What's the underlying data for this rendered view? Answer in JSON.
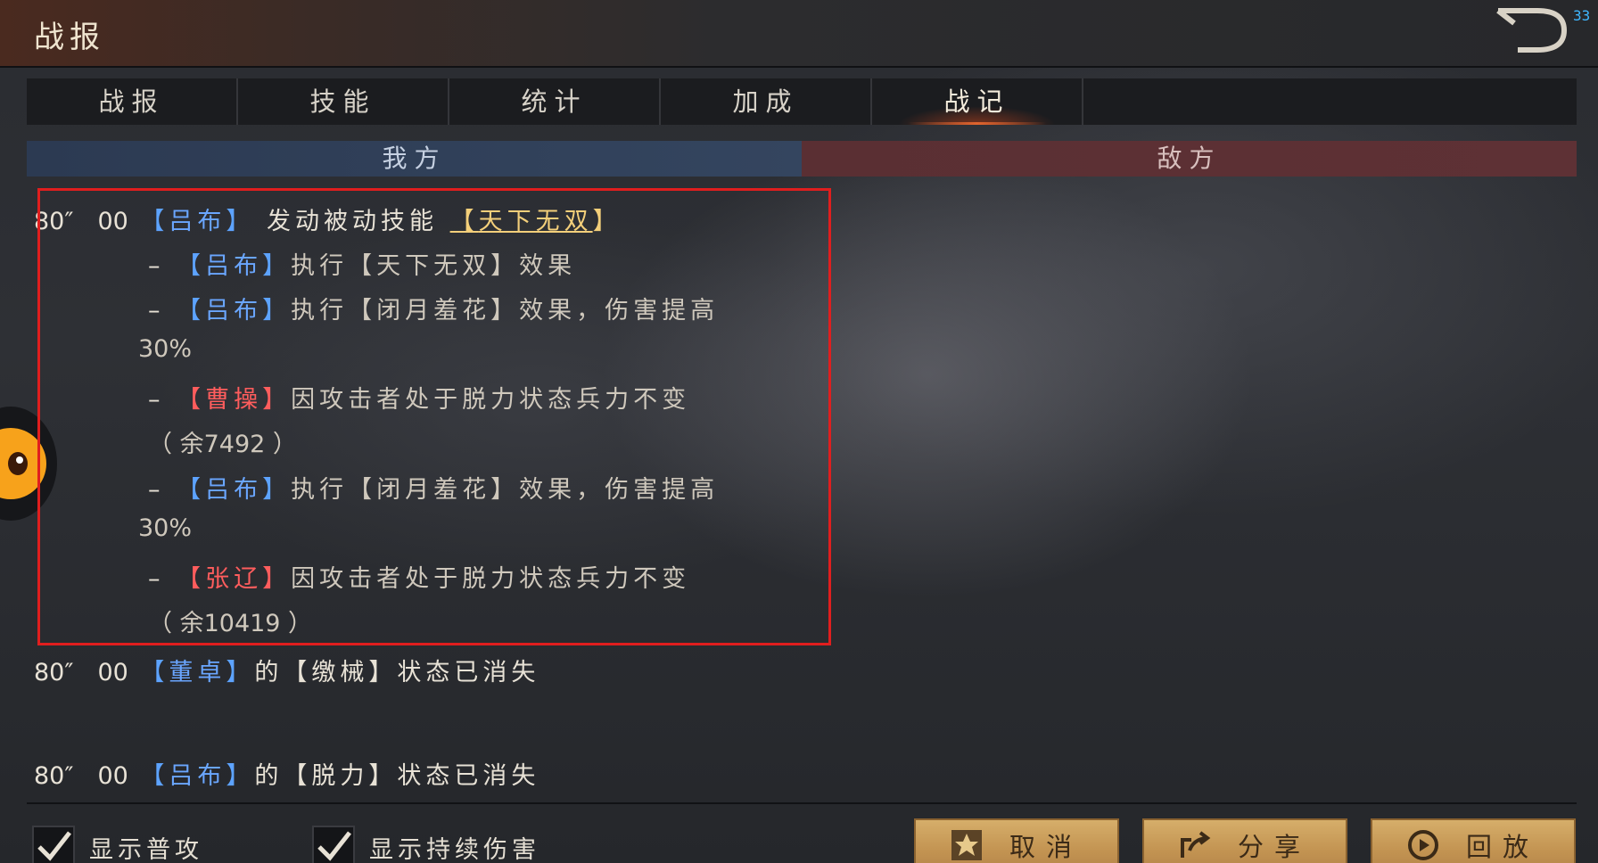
{
  "header": {
    "title": "战报",
    "fps": "33"
  },
  "tabs": [
    {
      "label": "战报"
    },
    {
      "label": "技能"
    },
    {
      "label": "统计"
    },
    {
      "label": "加成"
    },
    {
      "label": "战记"
    }
  ],
  "sides": {
    "ours": "我方",
    "enemy": "敌方"
  },
  "log": {
    "e1": {
      "time": "80″　00",
      "actor": "吕布",
      "text": "发动被动技能",
      "skill": "天下无双"
    },
    "e1a": {
      "actor": "吕布",
      "verb": "执行",
      "skill": "天下无双",
      "text": "效果"
    },
    "e1b": {
      "actor": "吕布",
      "verb": "执行",
      "skill": "闭月羞花",
      "text": "效果，伤害提高",
      "cont": "30%"
    },
    "e1c": {
      "actor": "曹操",
      "text": "因攻击者处于脱力状态兵力不变",
      "cont": "（ 余7492 ）"
    },
    "e1d": {
      "actor": "吕布",
      "verb": "执行",
      "skill": "闭月羞花",
      "text": "效果，伤害提高",
      "cont": "30%"
    },
    "e1e": {
      "actor": "张辽",
      "text": "因攻击者处于脱力状态兵力不变",
      "cont": "（ 余10419 ）"
    },
    "e2": {
      "time": "80″　00",
      "actor": "董卓",
      "mid": "的",
      "state": "缴械",
      "text": "状态已消失"
    },
    "e3": {
      "time": "80″　00",
      "actor": "吕布",
      "mid": "的",
      "state": "脱力",
      "text": "状态已消失"
    }
  },
  "options": {
    "show_normal_attack": "显示普攻",
    "show_dot": "显示持续伤害"
  },
  "buttons": {
    "cancel": "取消",
    "share": "分享",
    "replay": "回放"
  }
}
